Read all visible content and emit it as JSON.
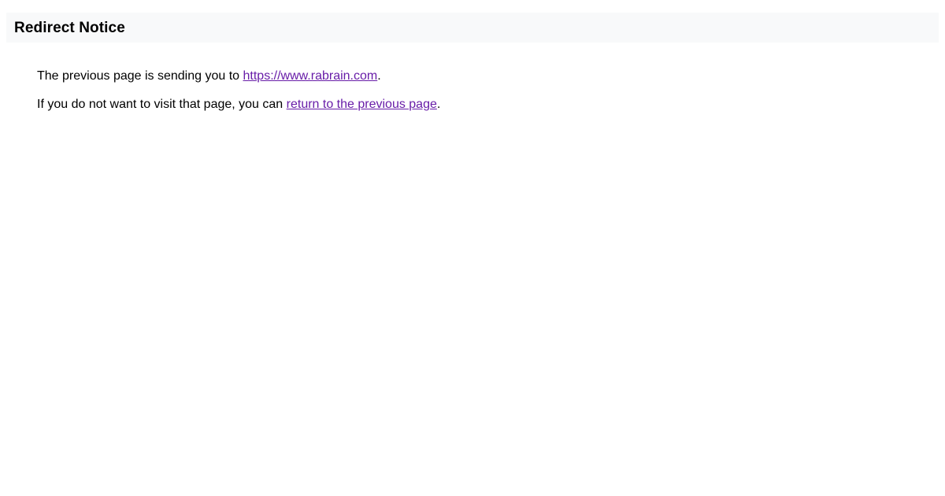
{
  "page": {
    "title": "Redirect Notice"
  },
  "message": {
    "line1_prefix": "The previous page is sending you to ",
    "redirect_link": "https://www.rabrain.com",
    "line1_suffix": ".",
    "line2_prefix": "If you do not want to visit that page, you can ",
    "back_link": "return to the previous page",
    "line2_suffix": "."
  },
  "colors": {
    "header_background": "#f8f9fa",
    "link": "#681da8",
    "text": "#000000"
  }
}
